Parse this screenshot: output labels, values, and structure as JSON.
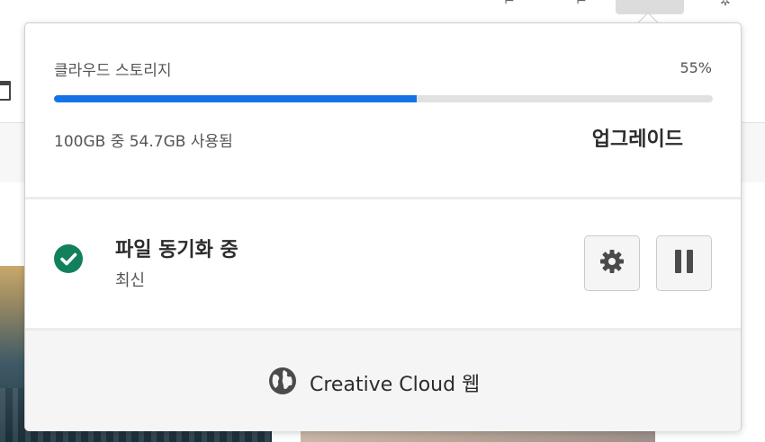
{
  "storage": {
    "title": "클라우드 스토리지",
    "percent_label": "55%",
    "percent_used": 0.55,
    "usage_text": "100GB 중 54.7GB 사용됨",
    "upgrade_label": "업그레이드"
  },
  "sync": {
    "title": "파일 동기화 중",
    "status": "최신",
    "status_icon": "check-circle-icon",
    "settings_icon": "gear-icon",
    "pause_icon": "pause-icon"
  },
  "web": {
    "label": "Creative Cloud 웹",
    "icon": "globe-icon"
  },
  "colors": {
    "accent": "#1473e6",
    "success": "#12805c",
    "track": "#e1e1e1",
    "text_primary": "#2c2c2c",
    "text_secondary": "#555555"
  }
}
